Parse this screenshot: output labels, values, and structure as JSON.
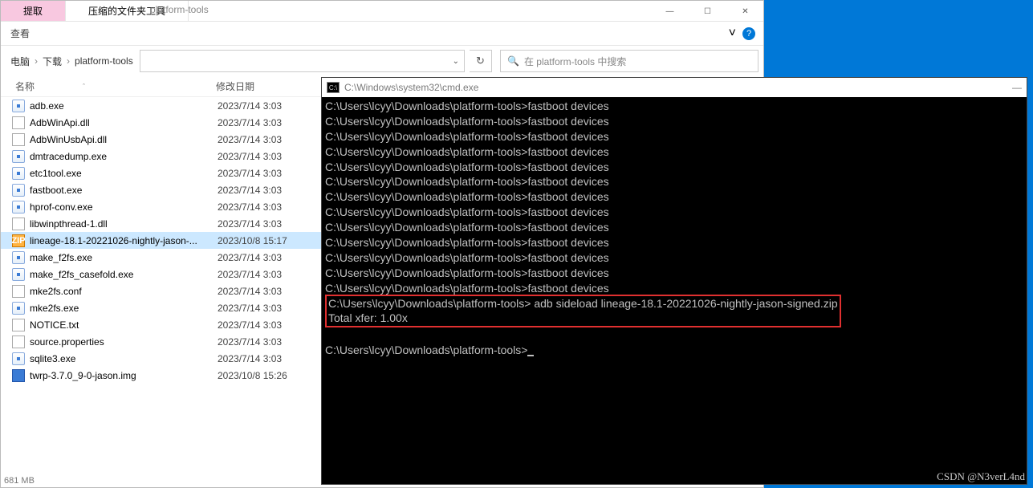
{
  "explorer": {
    "tabs": [
      "提取",
      "压缩的文件夹工具"
    ],
    "app_title": "platform-tools",
    "ribbon": {
      "view": "查看",
      "chevron": "˅"
    },
    "breadcrumb": [
      "电脑",
      "下载",
      "platform-tools"
    ],
    "refresh_glyph": "↻",
    "search": {
      "icon": "🔍",
      "placeholder": "在 platform-tools 中搜索"
    },
    "columns": {
      "name": "名称",
      "sort": "ˆ",
      "date": "修改日期"
    },
    "files": [
      {
        "icon": "exe",
        "name": "adb.exe",
        "date": "2023/7/14 3:03"
      },
      {
        "icon": "dll",
        "name": "AdbWinApi.dll",
        "date": "2023/7/14 3:03"
      },
      {
        "icon": "dll",
        "name": "AdbWinUsbApi.dll",
        "date": "2023/7/14 3:03"
      },
      {
        "icon": "exe",
        "name": "dmtracedump.exe",
        "date": "2023/7/14 3:03"
      },
      {
        "icon": "exe",
        "name": "etc1tool.exe",
        "date": "2023/7/14 3:03"
      },
      {
        "icon": "exe",
        "name": "fastboot.exe",
        "date": "2023/7/14 3:03"
      },
      {
        "icon": "exe",
        "name": "hprof-conv.exe",
        "date": "2023/7/14 3:03"
      },
      {
        "icon": "dll",
        "name": "libwinpthread-1.dll",
        "date": "2023/7/14 3:03"
      },
      {
        "icon": "zip",
        "name": "lineage-18.1-20221026-nightly-jason-...",
        "date": "2023/10/8 15:17",
        "sel": true
      },
      {
        "icon": "exe",
        "name": "make_f2fs.exe",
        "date": "2023/7/14 3:03"
      },
      {
        "icon": "exe",
        "name": "make_f2fs_casefold.exe",
        "date": "2023/7/14 3:03"
      },
      {
        "icon": "conf",
        "name": "mke2fs.conf",
        "date": "2023/7/14 3:03"
      },
      {
        "icon": "exe",
        "name": "mke2fs.exe",
        "date": "2023/7/14 3:03"
      },
      {
        "icon": "txt",
        "name": "NOTICE.txt",
        "date": "2023/7/14 3:03"
      },
      {
        "icon": "conf",
        "name": "source.properties",
        "date": "2023/7/14 3:03"
      },
      {
        "icon": "exe",
        "name": "sqlite3.exe",
        "date": "2023/7/14 3:03"
      },
      {
        "icon": "img",
        "name": "twrp-3.7.0_9-0-jason.img",
        "date": "2023/10/8 15:26"
      }
    ],
    "status": "681 MB",
    "winbtns": {
      "min": "—",
      "max": "☐",
      "close": "✕"
    }
  },
  "cmd": {
    "title_icon": "C:\\",
    "title": "C:\\Windows\\system32\\cmd.exe",
    "min": "—",
    "prompt": "C:\\Users\\lcyy\\Downloads\\platform-tools>",
    "cmd_fastboot": "fastboot devices",
    "cmd_sideload": " adb sideload lineage-18.1-20221026-nightly-jason-signed.zip",
    "xfer": "Total xfer: 1.00x",
    "repeat": 13
  },
  "watermark": "CSDN @N3verL4nd"
}
